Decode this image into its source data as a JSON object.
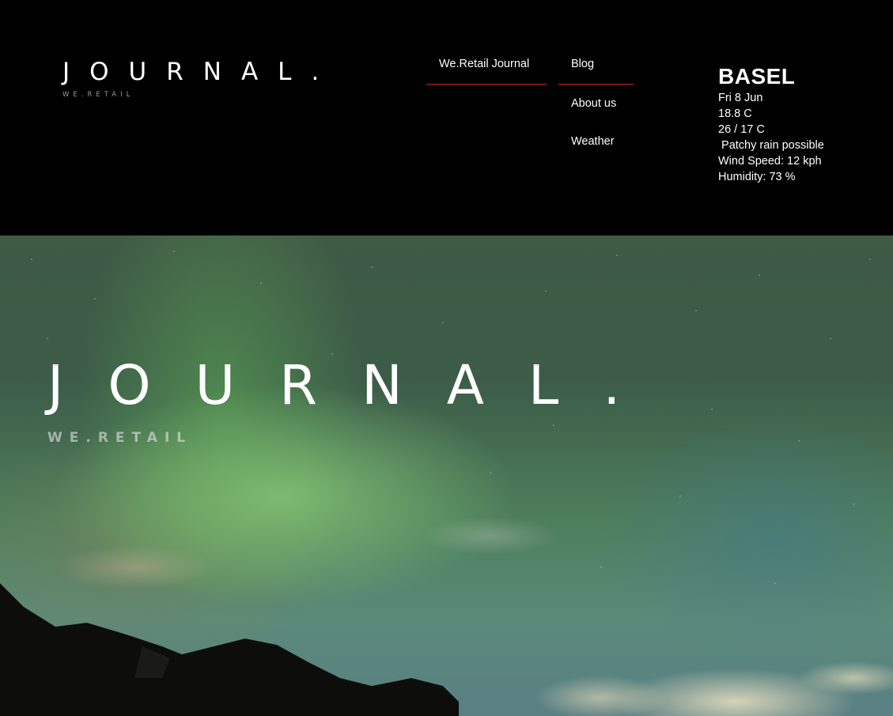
{
  "header": {
    "logo": {
      "title": "JOURNAL.",
      "subtitle": "WE.RETAIL"
    },
    "nav": {
      "home": "We.Retail Journal",
      "blog": "Blog",
      "about": "About us",
      "weather": "Weather"
    },
    "accent_color": "#d0202a"
  },
  "weather": {
    "city": "BASEL",
    "date": "Fri 8 Jun",
    "temperature": "18.8 C",
    "high_low": "26 / 17 C",
    "condition": " Patchy rain possible",
    "wind": "Wind Speed: 12 kph",
    "humidity": "Humidity: 73 %"
  },
  "hero": {
    "title": "JOURNAL.",
    "subtitle": "WE.RETAIL"
  }
}
